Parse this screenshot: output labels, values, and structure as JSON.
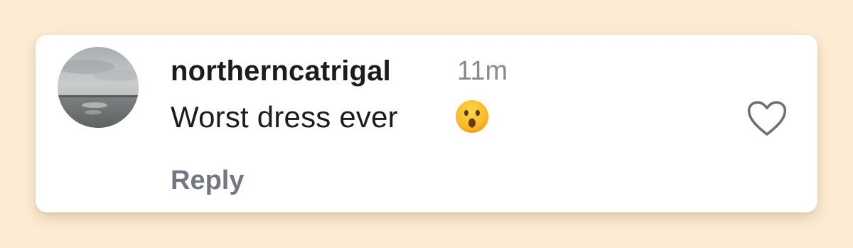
{
  "comment": {
    "username": "northerncatrigal",
    "timestamp": "11m",
    "text": "Worst dress ever",
    "emoji_icon": "hushed-face-icon",
    "reply_label": "Reply",
    "like_icon": "heart-outline-icon"
  },
  "colors": {
    "page_background": "#fdebd3",
    "card_background": "#ffffff",
    "username": "#1c1c1e",
    "timestamp": "#8a8a8e",
    "reply": "#737783",
    "like_icon": "#6e6e73"
  }
}
